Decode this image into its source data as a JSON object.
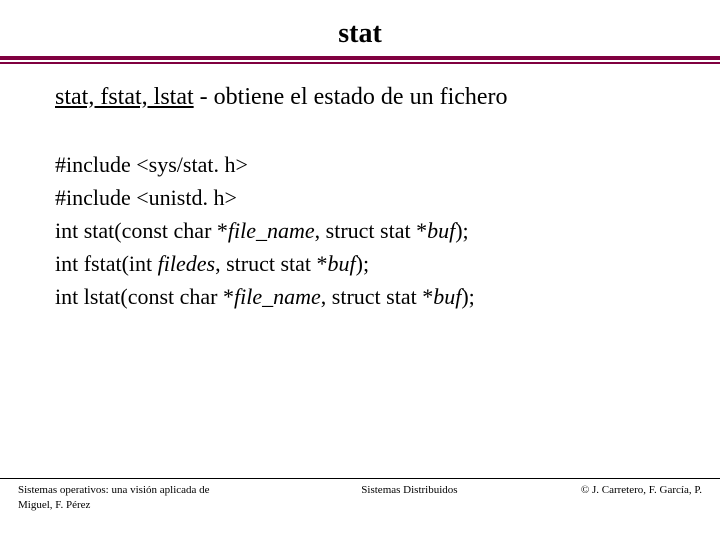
{
  "title": "stat",
  "subtitle": {
    "underlined": "stat, fstat, lstat",
    "rest": " - obtiene el estado de un fichero"
  },
  "code": {
    "lines": [
      [
        {
          "t": "#include <sys/stat. h>",
          "i": false
        }
      ],
      [
        {
          "t": "#include <unistd. h>",
          "i": false
        }
      ],
      [
        {
          "t": "int stat(const char *",
          "i": false
        },
        {
          "t": "file_name",
          "i": true
        },
        {
          "t": ", struct stat *",
          "i": false
        },
        {
          "t": "buf",
          "i": true
        },
        {
          "t": ");",
          "i": false
        }
      ],
      [
        {
          "t": "int fstat(int ",
          "i": false
        },
        {
          "t": "filedes",
          "i": true
        },
        {
          "t": ", struct stat *",
          "i": false
        },
        {
          "t": "buf",
          "i": true
        },
        {
          "t": ");",
          "i": false
        }
      ],
      [
        {
          "t": "int lstat(const char *",
          "i": false
        },
        {
          "t": "file_name",
          "i": true
        },
        {
          "t": ", struct stat *",
          "i": false
        },
        {
          "t": "buf",
          "i": true
        },
        {
          "t": ");",
          "i": false
        }
      ]
    ]
  },
  "footer": {
    "left": "Sistemas operativos: una visión aplicada de Miguel, F. Pérez",
    "center": "Sistemas Distribuidos",
    "right": "© J. Carretero, F. García, P."
  }
}
